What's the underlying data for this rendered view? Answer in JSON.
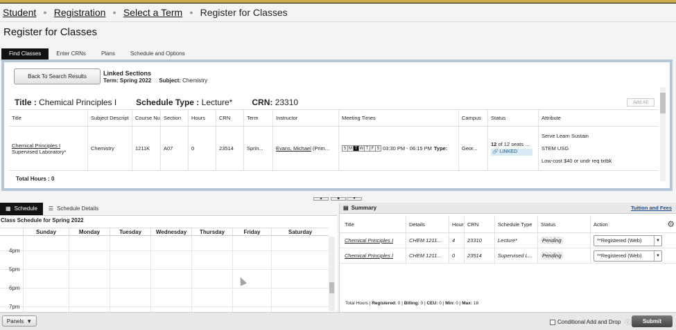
{
  "breadcrumb": {
    "items": [
      "Student",
      "Registration",
      "Select a Term"
    ],
    "current": "Register for Classes"
  },
  "page_title": "Register for Classes",
  "tabs": [
    "Find Classes",
    "Enter CRNs",
    "Plans",
    "Schedule and Options"
  ],
  "linked": {
    "back_label": "Back To Search Results",
    "title": "Linked Sections",
    "term_label": "Term:",
    "term_value": "Spring 2022",
    "subject_label": "Subject:",
    "subject_value": "Chemistry"
  },
  "section": {
    "title_label": "Title :",
    "title_value": "Chemical Principles I",
    "type_label": "Schedule Type :",
    "type_value": "Lecture*",
    "crn_label": "CRN:",
    "crn_value": "23310",
    "add_all": "Add All"
  },
  "grid": {
    "headers": [
      "Title",
      "Subject Descript",
      "Course Nu",
      "Section",
      "Hours",
      "CRN",
      "Term",
      "Instructor",
      "Meeting Times",
      "Campus",
      "Status",
      "Attribute"
    ],
    "row": {
      "title": "Chemical Principles I",
      "subtitle": "Supervised Laboratory*",
      "subject": "Chemistry",
      "course": "1211K",
      "section": "A07",
      "hours": "0",
      "crn": "23514",
      "term": "Sprin...",
      "instructor": "Evans, Michael",
      "instructor_role": "(Prim...",
      "days": [
        "S",
        "M",
        "T",
        "W",
        "T",
        "F",
        "S"
      ],
      "time": "03:30 PM - 06:15 PM",
      "type_label": "Type:",
      "campus": "Geor...",
      "status_count": "12",
      "status_rest": "of 12 seats ...",
      "linked": "LINKED",
      "attributes": [
        "Serve Learn Sustain",
        "STEM USG",
        "Low-cost $40 or undr req txtbk"
      ]
    },
    "total_hours": "Total Hours : 0"
  },
  "schedule": {
    "tabs": [
      "Schedule",
      "Schedule Details"
    ],
    "caption": "Class Schedule for Spring 2022",
    "days": [
      "Sunday",
      "Monday",
      "Tuesday",
      "Wednesday",
      "Thursday",
      "Friday",
      "Saturday"
    ],
    "hours": [
      "4pm",
      "5pm",
      "6pm",
      "7pm"
    ]
  },
  "summary": {
    "title": "Summary",
    "tuition_link": "Tuition and Fees",
    "headers": [
      "Title",
      "Details",
      "Hours",
      "CRN",
      "Schedule Type",
      "Status",
      "Action"
    ],
    "rows": [
      {
        "title": "Chemical Principles I",
        "details": "CHEM 1211...",
        "hours": "4",
        "crn": "23310",
        "type": "Lecture*",
        "status": "Pending",
        "action": "**Registered (Web)"
      },
      {
        "title": "Chemical Principles I",
        "details": "CHEM 1211...",
        "hours": "0",
        "crn": "23514",
        "type": "Supervised L...",
        "status": "Pending",
        "action": "**Registered (Web)"
      }
    ],
    "footer": {
      "total_label": "Total Hours |",
      "reg_label": "Registered:",
      "reg": "0",
      "bill_label": "Billing:",
      "bill": "0",
      "ceu_label": "CEU:",
      "ceu": "0",
      "min_label": "Min:",
      "min": "0",
      "max_label": "Max:",
      "max": "18"
    }
  },
  "bottom": {
    "panels": "Panels",
    "conditional": "Conditional Add and Drop",
    "submit": "Submit"
  }
}
